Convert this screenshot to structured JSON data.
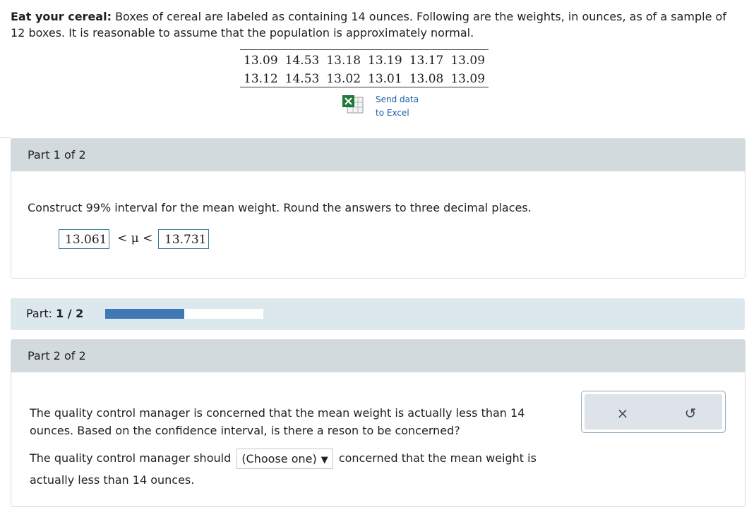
{
  "intro": {
    "title": "Eat your cereal:",
    "text": " Boxes of cereal are labeled as containing 14 ounces. Following are the weights, in ounces, as of a sample of 12 boxes. It is reasonable to assume that the population is approximately normal."
  },
  "data_table": [
    [
      "13.09",
      "14.53",
      "13.18",
      "13.19",
      "13.17",
      "13.09"
    ],
    [
      "13.12",
      "14.53",
      "13.02",
      "13.01",
      "13.08",
      "13.09"
    ]
  ],
  "excel": {
    "line1": "Send data",
    "line2": "to Excel",
    "icon": "excel-icon"
  },
  "part1": {
    "header": "Part 1 of 2",
    "question": "Construct 99% interval for the mean weight. Round the answers to three decimal places.",
    "lower": "13.061",
    "relation": "< μ <",
    "upper": "13.731"
  },
  "progress": {
    "label": "Part: ",
    "value": "1 / 2",
    "fraction": 0.5,
    "color": "#3e78b5"
  },
  "part2": {
    "header": "Part 2 of 2",
    "question": "The quality control manager is concerned that the mean weight is actually less than 14 ounces. Based on the confidence interval, is there a reson to be concerned?",
    "sentence_start": "The quality control manager should",
    "select_value": "(Choose one)",
    "sentence_end": "concerned that the mean weight is actually less than 14 ounces."
  },
  "toolbox": {
    "clear": "×",
    "reset": "↺"
  }
}
